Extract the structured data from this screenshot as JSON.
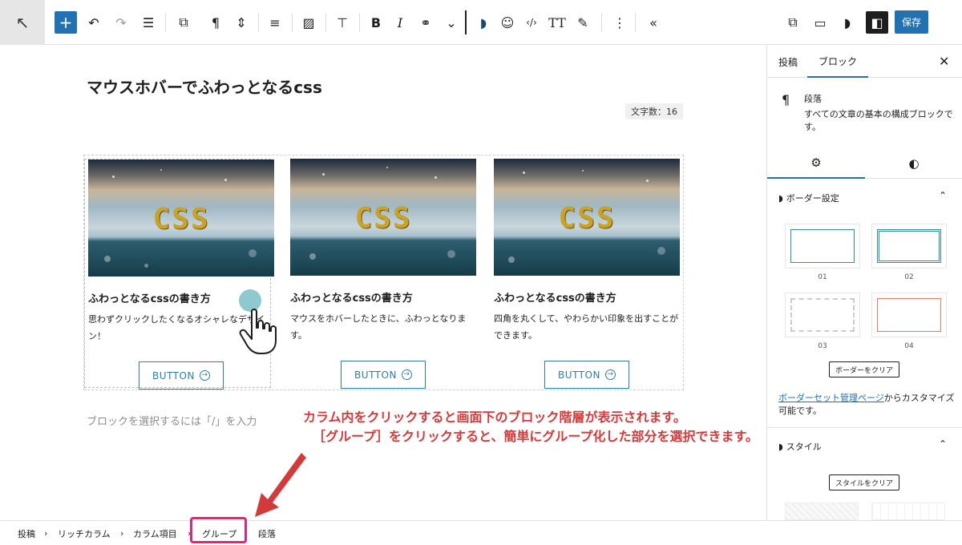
{
  "toolbar": {
    "colors": {
      "accent": "#2271b1"
    },
    "items": [
      {
        "icon": "select-arrow-icon",
        "glyph": "↖"
      },
      {
        "icon": "add-block-icon",
        "glyph": "+"
      },
      {
        "icon": "undo-icon",
        "glyph": "↶"
      },
      {
        "icon": "redo-icon",
        "glyph": "↷"
      },
      {
        "icon": "list-view-icon",
        "glyph": "☰"
      },
      {
        "icon": "block-transform-icon",
        "glyph": "⧉"
      },
      {
        "icon": "paragraph-icon",
        "glyph": "¶"
      },
      {
        "icon": "move-arrows-icon",
        "glyph": "⇕"
      },
      {
        "icon": "align-left-icon",
        "glyph": "≡"
      },
      {
        "icon": "image-icon",
        "glyph": "▨"
      },
      {
        "icon": "text-align-icon",
        "glyph": "⊤"
      },
      {
        "icon": "bold-icon",
        "glyph": "B"
      },
      {
        "icon": "italic-icon",
        "glyph": "I"
      },
      {
        "icon": "link-icon",
        "glyph": "⚭"
      },
      {
        "icon": "chevron-down-icon",
        "glyph": "⌄"
      },
      {
        "icon": "theme-leaf-icon",
        "glyph": "◗"
      },
      {
        "icon": "emoji-icon",
        "glyph": "☺"
      },
      {
        "icon": "code-icon",
        "glyph": "‹/›"
      },
      {
        "icon": "font-size-icon",
        "glyph": "TT"
      },
      {
        "icon": "highlighter-icon",
        "glyph": "✎"
      },
      {
        "icon": "more-options-icon",
        "glyph": "⋮"
      },
      {
        "icon": "collapse-toolbar-icon",
        "glyph": "«"
      },
      {
        "icon": "external-preview-icon",
        "glyph": "⧉"
      },
      {
        "icon": "desktop-preview-icon",
        "glyph": "▭"
      },
      {
        "icon": "theme-leaf-icon",
        "glyph": "◗"
      },
      {
        "icon": "sidebar-toggle-icon",
        "glyph": "◧"
      }
    ],
    "save_label": "保存"
  },
  "editor": {
    "post_title": "マウスホバーでふわっとなるcss",
    "char_count": "文字数：16",
    "columns": [
      {
        "image_text": "CSS",
        "title": "ふわっとなるcssの書き方",
        "desc": "思わずクリックしたくなるオシャレなデザイン！",
        "button": "BUTTON"
      },
      {
        "image_text": "CSS",
        "title": "ふわっとなるcssの書き方",
        "desc": "マウスをホバーしたときに、ふわっとなります。",
        "button": "BUTTON"
      },
      {
        "image_text": "CSS",
        "title": "ふわっとなるcssの書き方",
        "desc": "四角を丸くして、やわらかい印象を出すことができます。",
        "button": "BUTTON"
      }
    ],
    "placeholder": "ブロックを選択するには「/」を入力",
    "annotation_line1": "カラム内をクリックすると画面下のブロック階層が表示されます。",
    "annotation_line2": "［グループ］をクリックすると、簡単にグループ化した部分を選択できます。",
    "annotation_color": "#d33a3a"
  },
  "sidebar": {
    "tabs": [
      "投稿",
      "ブロック"
    ],
    "active_tab": "ブロック",
    "block_name": "段落",
    "block_desc": "すべての文章の基本の構成ブロックです。",
    "border_panel_title": "ボーダー設定",
    "border_options": [
      {
        "label": "01",
        "style": "solid",
        "color": "#2e8fa8"
      },
      {
        "label": "02",
        "style": "double",
        "color": "#2e8fa8"
      },
      {
        "label": "03",
        "style": "dashed",
        "color": "#cccccc"
      },
      {
        "label": "04",
        "style": "solid",
        "color": "#e07a6a"
      }
    ],
    "clear_border": "ボーダーをクリア",
    "note_link": "ボーダーセット管理ページ",
    "note_rest": "からカスタマイズ可能です。",
    "style_panel_title": "スタイル",
    "clear_style": "スタイルをクリア"
  },
  "breadcrumb": {
    "items": [
      "投稿",
      "リッチカラム",
      "カラム項目",
      "グループ",
      "段落"
    ],
    "separator": "›",
    "highlight_color": "#e0257a"
  }
}
